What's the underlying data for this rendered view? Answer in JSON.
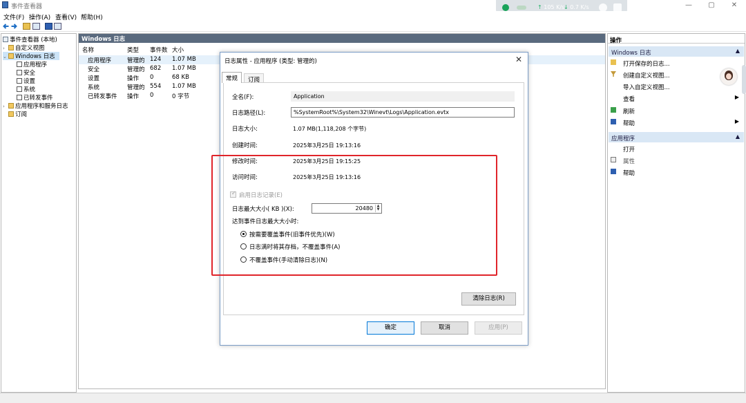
{
  "window": {
    "title": "事件查看器",
    "controls": {
      "minimize": "—",
      "maximize": "▢",
      "close": "✕"
    }
  },
  "tray": {
    "speed_up": "105",
    "speed_up_unit": "K/s",
    "speed_down": "0.7",
    "speed_down_unit": "K/s"
  },
  "menu": {
    "file": "文件(F)",
    "action": "操作(A)",
    "view": "查看(V)",
    "help": "帮助(H)"
  },
  "tree": {
    "root": "事件查看器 (本地)",
    "custom_views": "自定义视图",
    "windows_logs": "Windows 日志",
    "logs": [
      "应用程序",
      "安全",
      "设置",
      "系统",
      "已转发事件"
    ],
    "app_service_logs": "应用程序和服务日志",
    "subscriptions": "订阅"
  },
  "center": {
    "header": "Windows 日志",
    "columns": [
      "名称",
      "类型",
      "事件数",
      "大小"
    ],
    "rows": [
      {
        "name": "应用程序",
        "type": "管理的",
        "count": "124",
        "size": "1.07 MB"
      },
      {
        "name": "安全",
        "type": "管理的",
        "count": "682",
        "size": "1.07 MB"
      },
      {
        "name": "设置",
        "type": "操作",
        "count": "0",
        "size": "68 KB"
      },
      {
        "name": "系统",
        "type": "管理的",
        "count": "554",
        "size": "1.07 MB"
      },
      {
        "name": "已转发事件",
        "type": "操作",
        "count": "0",
        "size": "0 字节"
      }
    ]
  },
  "actions": {
    "title": "操作",
    "section1": "Windows 日志",
    "items1": [
      "打开保存的日志...",
      "创建自定义视图...",
      "导入自定义视图...",
      "查看",
      "刷新",
      "帮助"
    ],
    "section2": "应用程序",
    "items2": [
      "打开",
      "属性",
      "帮助"
    ]
  },
  "dialog": {
    "title": "日志属性 - 应用程序 (类型: 管理的)",
    "tabs": [
      "常规",
      "订阅"
    ],
    "full_name_label": "全名(F):",
    "full_name": "Application",
    "path_label": "日志路径(L):",
    "path": "%SystemRoot%\\System32\\Winevt\\Logs\\Application.evtx",
    "size_label": "日志大小:",
    "size": "1.07 MB(1,118,208 个字节)",
    "created_label": "创建时间:",
    "created": "2025年3月25日 19:13:16",
    "modified_label": "修改时间:",
    "modified": "2025年3月25日 19:15:25",
    "accessed_label": "访问时间:",
    "accessed": "2025年3月25日 19:13:16",
    "enable_logging": "启用日志记录(E)",
    "max_size_label": "日志最大大小( KB )(X):",
    "max_size": "20480",
    "when_max_label": "达到事件日志最大大小时:",
    "options": [
      "按需要覆盖事件(旧事件优先)(W)",
      "日志满时将其存档，不覆盖事件(A)",
      "不覆盖事件(手动清除日志)(N)"
    ],
    "clear_button": "清除日志(R)",
    "ok_button": "确定",
    "cancel_button": "取消",
    "apply_button": "应用(P)"
  },
  "colors": {
    "annotation": "#e0242a",
    "selection": "#cce4f7",
    "panel_header": "#5a6a7e",
    "accent": "#0078d7"
  }
}
